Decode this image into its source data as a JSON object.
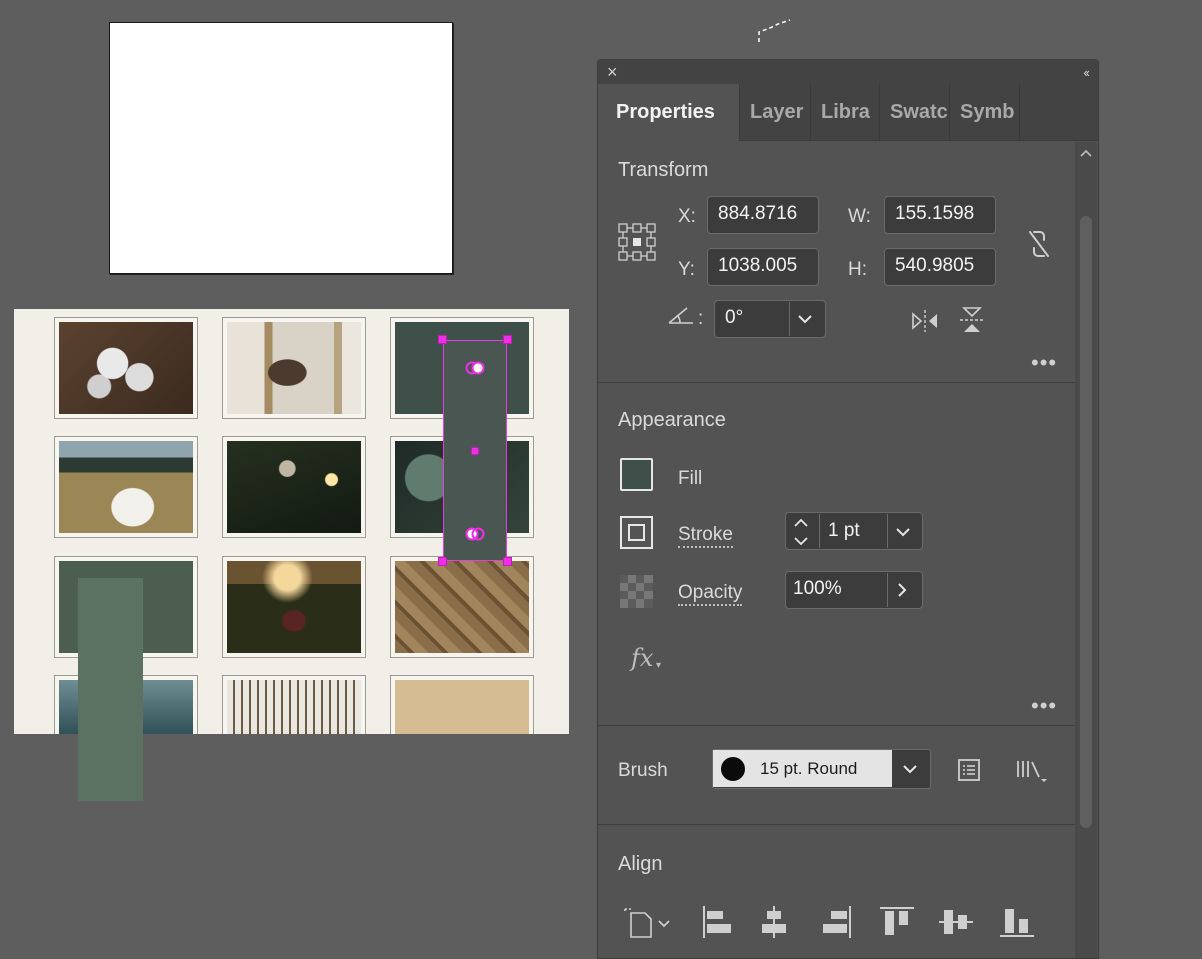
{
  "panel": {
    "tabs": [
      {
        "label": "Properties"
      },
      {
        "label": "Layer"
      },
      {
        "label": "Libra"
      },
      {
        "label": "Swatc"
      },
      {
        "label": "Symb"
      }
    ]
  },
  "transform": {
    "title": "Transform",
    "x_label": "X:",
    "x_value": "884.8716",
    "y_label": "Y:",
    "y_value": "1038.005",
    "w_label": "W:",
    "w_value": "155.1598",
    "h_label": "H:",
    "h_value": "540.9805",
    "angle_label": ":",
    "angle_value": "0°"
  },
  "appearance": {
    "title": "Appearance",
    "fill_label": "Fill",
    "fill_color": "#3f4f4a",
    "stroke_label": "Stroke",
    "stroke_value": "1 pt",
    "opacity_label": "Opacity",
    "opacity_value": "100%",
    "fx_label": "fx"
  },
  "brush": {
    "label": "Brush",
    "value": "15 pt. Round"
  },
  "align": {
    "title": "Align"
  },
  "colors": {
    "selection": "#e83cdf",
    "panel_bg": "#535353",
    "canvas_bg": "#5e5e5e"
  }
}
